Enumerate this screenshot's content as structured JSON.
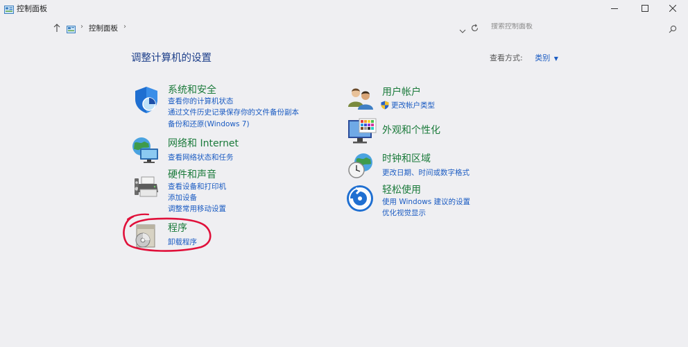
{
  "window": {
    "title": "控制面板",
    "controls": {
      "minimize": "minimize",
      "maximize": "maximize",
      "close": "close"
    }
  },
  "address_bar": {
    "breadcrumb": [
      "控制面板"
    ],
    "search_placeholder": "搜索控制面板"
  },
  "main": {
    "title": "调整计算机的设置",
    "view_by_label": "查看方式:",
    "view_by_value": "类别"
  },
  "categories": [
    {
      "title": "系统和安全",
      "icon": "shield-icon",
      "links": [
        "查看你的计算机状态",
        "通过文件历史记录保存你的文件备份副本",
        "备份和还原(Windows 7)"
      ]
    },
    {
      "title": "网络和 Internet",
      "icon": "network-globe-icon",
      "links": [
        "查看网络状态和任务"
      ]
    },
    {
      "title": "硬件和声音",
      "icon": "printer-speaker-icon",
      "links": [
        "查看设备和打印机",
        "添加设备",
        "调整常用移动设置"
      ]
    },
    {
      "title": "程序",
      "icon": "programs-disc-icon",
      "links": [
        "卸载程序"
      ]
    },
    {
      "title": "用户帐户",
      "icon": "users-icon",
      "links": [
        "更改帐户类型"
      ]
    },
    {
      "title": "外观和个性化",
      "icon": "monitor-palette-icon",
      "links": []
    },
    {
      "title": "时钟和区域",
      "icon": "clock-globe-icon",
      "links": [
        "更改日期、时间或数字格式"
      ]
    },
    {
      "title": "轻松使用",
      "icon": "ease-of-access-icon",
      "links": [
        "使用 Windows 建议的设置",
        "优化视觉显示"
      ]
    }
  ],
  "colors": {
    "background": "#efeff2",
    "category_title": "#1a7a3a",
    "link": "#1a5bc2",
    "heading": "#1d3f8a",
    "annotation": "#e0103a"
  }
}
